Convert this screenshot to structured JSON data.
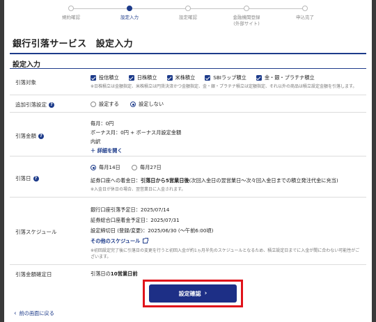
{
  "steps": [
    {
      "label": "規約確認"
    },
    {
      "label": "設定入力"
    },
    {
      "label": "設定確認"
    },
    {
      "label": "金融機関登録\n(外部サイト)"
    },
    {
      "label": "申込完了"
    }
  ],
  "page_title": "銀行引落サービス　設定入力",
  "section_title": "設定入力",
  "target": {
    "label": "引落対象",
    "options": [
      "投信積立",
      "日株積立",
      "米株積立",
      "SBIラップ積立",
      "金・銀・プラチナ積立"
    ],
    "note": "※日株積立は金額指定、米株積立は円貨決済かつ金額指定、金・銀・プラチナ積立は定額指定、それ以外の商品は積立設定金額を引落します。"
  },
  "additional": {
    "label": "追加引落設定",
    "options": [
      "設定する",
      "設定しない"
    ],
    "selected": "設定しない"
  },
  "amount": {
    "label": "引落金額",
    "monthly": "毎月：0円",
    "bonus": "ボーナス月：0円 + ボーナス月設定金額",
    "breakdown": "内訳",
    "detail_link": "＋ 詳細を開く"
  },
  "date": {
    "label": "引落日",
    "options": [
      "毎月14日",
      "毎月27日"
    ],
    "selected": "毎月14日",
    "deposit_prefix": "証券口座への着金日：",
    "deposit_bold": "引落日から5営業日後",
    "deposit_suffix": "(次回入金日の翌営業日〜次々回入金日までの積立発注代金に充当)",
    "note": "※入金日が休日の場合、翌営業日に入金されます。"
  },
  "schedule": {
    "label": "引落スケジュール",
    "bank_date": "銀行口座引落予定日：2025/07/14",
    "securities_date": "証券総合口座着金予定日：2025/07/31",
    "deadline": "設定締切日 (登録/変更)：2025/06/30 (〜午前6:00頃)",
    "other_link": "その他のスケジュール",
    "note": "※初回設定完了後に引落日の変更を行うと初回入金が約1ヵ月半先のスケジュールとなるため、積立設定日までに入金が間に合わない可能性がございます。"
  },
  "amount_fixed": {
    "label": "引落金額確定日",
    "value_prefix": "引落日の",
    "value_bold": "10営業日前"
  },
  "confirm_button": "設定確認",
  "back_link": "前の画面に戻る",
  "colors": {
    "accent": "#1d3b8a",
    "button": "#1d2f86",
    "highlight": "#e0121a"
  }
}
